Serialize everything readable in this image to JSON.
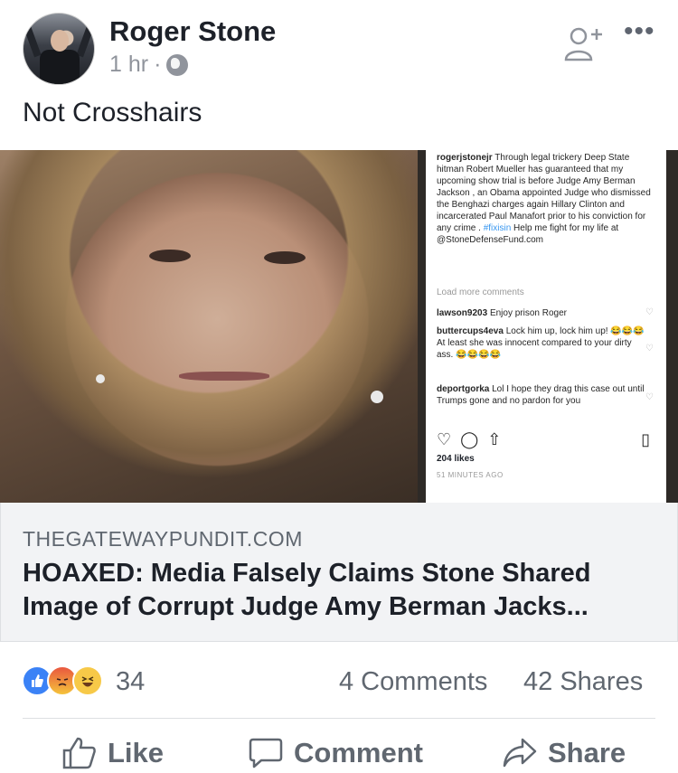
{
  "post": {
    "author": "Roger Stone",
    "time": "1 hr",
    "separator": "·",
    "status_text": "Not Crosshairs",
    "more_label": "•••"
  },
  "link_preview": {
    "domain": "THEGATEWAYPUNDIT.COM",
    "headline": "HOAXED: Media Falsely Claims Stone Shared Image of Corrupt Judge Amy Berman Jacks...",
    "instagram": {
      "caption_user": "rogerjstonejr",
      "caption_body": "Through legal trickery Deep State hitman Robert Mueller has guaranteed that my upcoming show trial is before Judge Amy Berman Jackson , an Obama appointed Judge who dismissed the Benghazi charges again Hillary Clinton and incarcerated Paul Manafort prior to his conviction for any crime .",
      "caption_hashtag": "#fixisin",
      "caption_end": "Help me fight for my life at @StoneDefenseFund.com",
      "load_more": "Load more comments",
      "comments": [
        {
          "user": "lawson9203",
          "text": "Enjoy prison Roger"
        },
        {
          "user": "buttercups4eva",
          "text": "Lock him up, lock him up! 😂😂😂 At least she was innocent compared to your dirty ass. 😂😂😂😂"
        },
        {
          "user": "deportgorka",
          "text": "Lol I hope they drag this case out until Trumps gone and no pardon for you"
        }
      ],
      "likes": "204 likes",
      "time_ago": "51 MINUTES AGO"
    }
  },
  "reactions": {
    "count": "34",
    "comments": "4 Comments",
    "shares": "42 Shares"
  },
  "actions": {
    "like": "Like",
    "comment": "Comment",
    "share": "Share"
  }
}
